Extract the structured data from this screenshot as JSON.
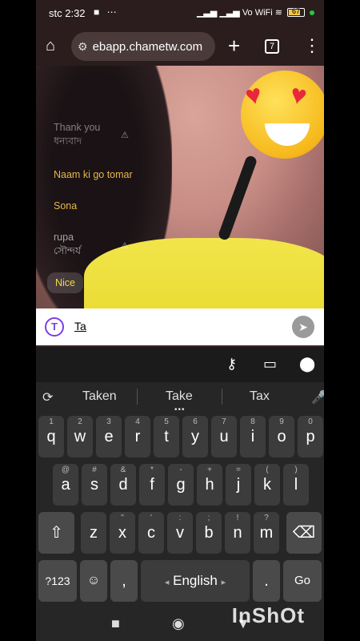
{
  "status_bar": {
    "carrier_time": "stc 2:32",
    "status_icons": "■ ⋯",
    "right_icons": "▁▃▅ ▁▃▅ Vo WiFi ≋",
    "battery_level": "67"
  },
  "browser": {
    "url": "ebapp.chametw.com",
    "tab_count": "7"
  },
  "chat": {
    "messages": [
      {
        "text": "Thank you",
        "sub": "ধন্যবাদ"
      },
      {
        "text": "Naam ki go tomar"
      },
      {
        "text": "Sona"
      },
      {
        "text": "rupa",
        "sub": "সৌন্দর্য"
      },
      {
        "text": "Nice"
      }
    ]
  },
  "composer": {
    "logo_letter": "T",
    "value": "Ta"
  },
  "keyboard": {
    "suggestions": [
      "Taken",
      "Take",
      "Tax"
    ],
    "row1": [
      [
        "q",
        "1"
      ],
      [
        "w",
        "2"
      ],
      [
        "e",
        "3"
      ],
      [
        "r",
        "4"
      ],
      [
        "t",
        "5"
      ],
      [
        "y",
        "6"
      ],
      [
        "u",
        "7"
      ],
      [
        "i",
        "8"
      ],
      [
        "o",
        "9"
      ],
      [
        "p",
        "0"
      ]
    ],
    "row2": [
      [
        "a",
        "@"
      ],
      [
        "s",
        "#"
      ],
      [
        "d",
        "&"
      ],
      [
        "f",
        "*"
      ],
      [
        "g",
        "-"
      ],
      [
        "h",
        "+"
      ],
      [
        "j",
        "="
      ],
      [
        "k",
        "("
      ],
      [
        "l",
        ")"
      ]
    ],
    "row3": [
      [
        "z",
        ""
      ],
      [
        "x",
        "\""
      ],
      [
        "c",
        "'"
      ],
      [
        "v",
        ":"
      ],
      [
        "b",
        ";"
      ],
      [
        "n",
        "!"
      ],
      [
        "m",
        "?"
      ]
    ],
    "symbols_label": "?123",
    "comma": ",",
    "space_label": "English",
    "period": ".",
    "go_label": "Go"
  },
  "watermark": "InShOt"
}
